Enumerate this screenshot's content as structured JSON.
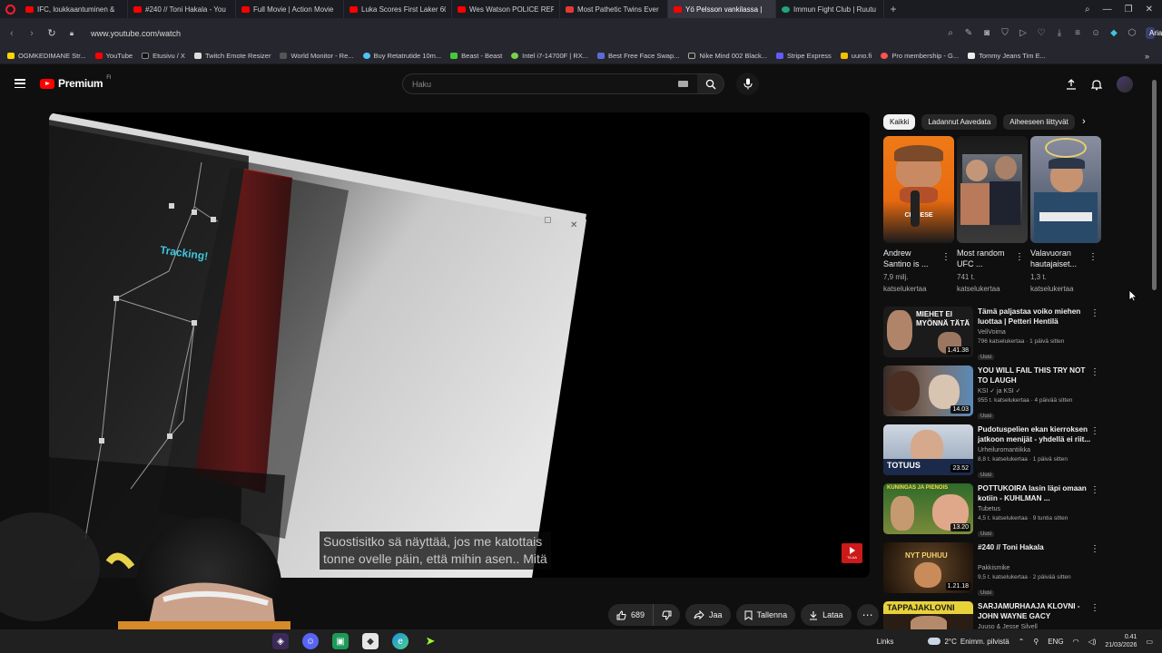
{
  "browser": {
    "tabs": [
      {
        "label": "IFC, loukkaantuminen &",
        "fav": "red"
      },
      {
        "label": "#240 // Toni Hakala - You",
        "fav": "red"
      },
      {
        "label": "Full Movie | Action Movie",
        "fav": "red"
      },
      {
        "label": "Luka Scores First Laker 60",
        "fav": "red"
      },
      {
        "label": "Wes Watson POLICE REPO",
        "fav": "red"
      },
      {
        "label": "Most Pathetic Twins Ever",
        "fav": "red2"
      },
      {
        "label": "Yö Pelsson vankilassa |",
        "fav": "red",
        "active": true
      },
      {
        "label": "Immun Fight Club | Ruutu",
        "fav": "green"
      }
    ],
    "url": "www.youtube.com/watch",
    "aria_label": "Aria",
    "bookmarks": [
      "OGMKEDIMANE Str...",
      "YouTube",
      "Etusivu / X",
      "Twitch Emote Resizer",
      "World Monitor - Re...",
      "Buy Retatrutide 10m...",
      "Beast - Beast",
      "Intel i7-14700F | RX...",
      "Best Free Face Swap...",
      "Nike Mind 002 Black...",
      "Stripe Express",
      "uuno.fi",
      "Pro membership - G...",
      "Tommy Jeans Tim E..."
    ]
  },
  "youtube": {
    "logo_word": "Premium",
    "region": "FI",
    "search_placeholder": "Haku",
    "video": {
      "overlay_text": "Tracking!",
      "subtitle_line1": "Suostisitko sä näyttää, jos me katottais",
      "subtitle_line2": "tonne ovelle päin, että mihin asen.. Mitä",
      "subscribe_label": "TILAA"
    },
    "actions": {
      "likes": "689",
      "share": "Jaa",
      "save": "Tallenna",
      "download": "Lataa"
    },
    "chips": [
      "Kaikki",
      "Ladannut Aavedata",
      "Aiheeseen liittyvät"
    ],
    "shorts": [
      {
        "title": "Andrew Santino is ...",
        "views_line1": "7,9 milj.",
        "views_line2": "katselukertaa",
        "thumb_text": "CHINESE"
      },
      {
        "title": "Most random UFC ...",
        "views_line1": "741 t.",
        "views_line2": "katselukertaa",
        "thumb_text": ""
      },
      {
        "title": "Valavuoran hautajaiset...",
        "views_line1": "1,3 t.",
        "views_line2": "katselukertaa",
        "thumb_text": ""
      }
    ],
    "recommendations": [
      {
        "title": "Tämä paljastaa voiko miehen luottaa | Petteri Hentilä",
        "channel": "VeliVoima",
        "stats": "796 katselukertaa · 1 päivä sitten",
        "badge": "Uusi",
        "duration": "1.41.38",
        "thumb_text": "MIEHET EI MYÖNNÄ TÄTÄ"
      },
      {
        "title": "YOU WILL FAIL THIS TRY NOT TO LAUGH",
        "channel": "KSI ✓ ja KSI ✓",
        "stats": "955 t. katselukertaa · 4 päivää sitten",
        "badge": "Uusi",
        "duration": "14.03",
        "thumb_text": ""
      },
      {
        "title": "Pudotuspelien ekan kierroksen jatkoon menijät - yhdellä ei riit...",
        "channel": "Urheiluromantiikka",
        "stats": "8,8 t. katselukertaa · 1 päivä sitten",
        "badge": "Uusi",
        "duration": "23.52",
        "thumb_text": "TOTUUS"
      },
      {
        "title": "POTTUKOIRA lasin läpi omaan kotiin - KUHLMAN ...",
        "channel": "Tubetus",
        "stats": "4,5 t. katselukertaa · 9 tuntia sitten",
        "badge": "Uusi",
        "duration": "13.20",
        "thumb_text": "KUNINGAS JA PIENOIS"
      },
      {
        "title": "#240 // Toni Hakala",
        "channel": "Pakkismike",
        "stats": "9,5 t. katselukertaa · 2 päivää sitten",
        "badge": "Uusi",
        "duration": "1.21.18",
        "thumb_text": "NYT PUHUU"
      },
      {
        "title": "SARJAMURHAAJA KLOVNI - JOHN WAYNE GACY",
        "channel": "Juuso & Jesse Silvell",
        "stats": "",
        "badge": "",
        "duration": "",
        "thumb_text": "TAPPAJAKLOVNI"
      }
    ]
  },
  "taskbar": {
    "links": "Links",
    "temperature": "2°C",
    "weather": "Enimm. pilvistä",
    "language": "ENG",
    "time": "0.41",
    "date": "21/03/2026"
  },
  "colors": {
    "accent_red": "#ff0000",
    "background": "#0f0f0f",
    "chip_bg": "#272727",
    "tracking_cyan": "#3ec7de"
  }
}
